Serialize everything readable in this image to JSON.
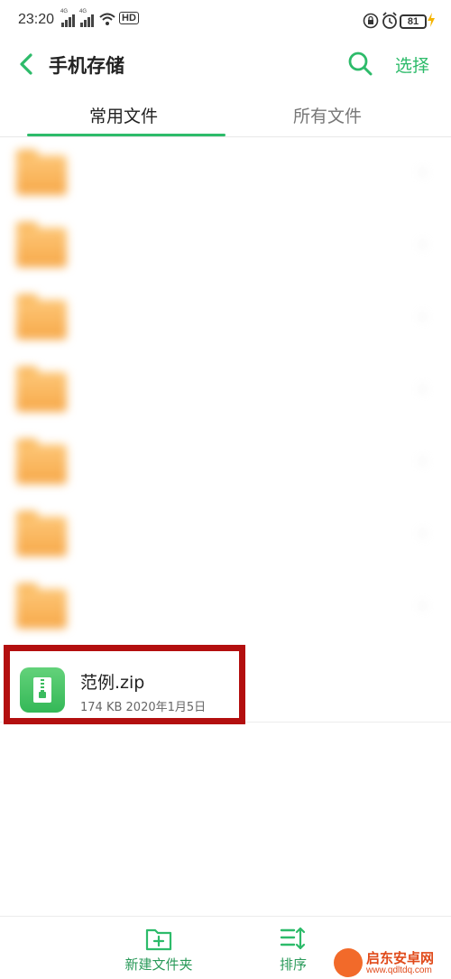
{
  "status_bar": {
    "time": "23:20",
    "signal_labels": [
      "4G",
      "4G"
    ],
    "hd_label": "HD",
    "battery": "81"
  },
  "header": {
    "title": "手机存储",
    "select_label": "选择"
  },
  "tabs": [
    {
      "label": "常用文件",
      "active": true
    },
    {
      "label": "所有文件",
      "active": false
    }
  ],
  "folders": [
    {
      "name": "",
      "blurred": true
    },
    {
      "name": "",
      "blurred": true
    },
    {
      "name": "",
      "blurred": true
    },
    {
      "name": "",
      "blurred": true
    },
    {
      "name": "",
      "blurred": true
    },
    {
      "name": "",
      "blurred": true
    },
    {
      "name": "",
      "blurred": true
    }
  ],
  "zip_file": {
    "name": "范例.zip",
    "meta": "174 KB  2020年1月5日"
  },
  "bottom_bar": {
    "new_folder_label": "新建文件夹",
    "sort_label": "排序"
  },
  "watermark": {
    "title": "启东安卓网",
    "url": "www.qdltdq.com"
  },
  "colors": {
    "accent": "#2dbb6a",
    "highlight": "#b30f0f",
    "folder": "#f8b14e"
  }
}
